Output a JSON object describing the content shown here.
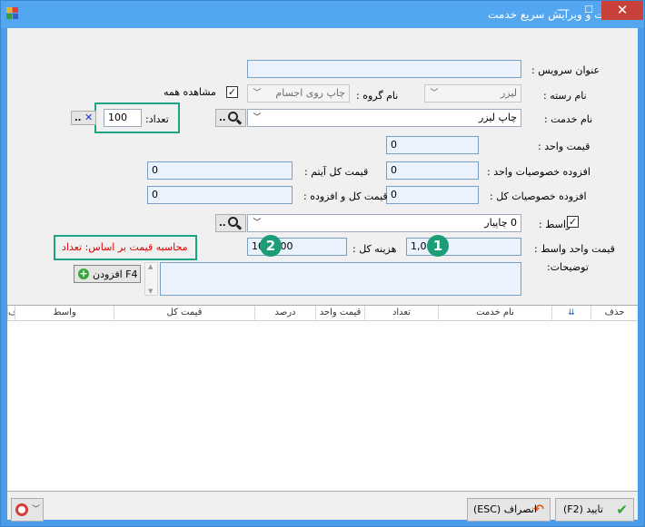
{
  "window": {
    "title": "ثبت و ویرایش سریع خدمت",
    "minimize": "—",
    "maximize": "☐",
    "close": "✕"
  },
  "form": {
    "service_title_label": "عنوان سرویس :",
    "service_title_value": "",
    "category_label": "نام رسته :",
    "category_value": "لیزر",
    "group_label": "نام گروه :",
    "group_value": "چاپ روی اجسام",
    "show_all_label": "مشاهده همه",
    "show_all_checked": "✓",
    "service_name_label": "نام خدمت :",
    "service_name_value": "چاپ لیزر",
    "count_label": "تعداد:",
    "count_value": "100",
    "count_clear": "✕",
    "count_dots": "..",
    "unit_price_label": "قیمت واحد :",
    "unit_price_value": "0",
    "unit_features_label": "افزوده خصوصیات واحد :",
    "unit_features_value": "0",
    "item_total_label": "قیمت کل آیتم :",
    "item_total_value": "0",
    "total_features_label": "افزوده خصوصیات کل :",
    "total_features_value": "0",
    "total_with_addon_label": "قیمت کل و افزوده :",
    "total_with_addon_value": "0",
    "broker_label": "واسط :",
    "broker_checked": "✓",
    "broker_value": "0 چاپیار",
    "broker_dots": "..",
    "broker_unit_price_label": "قیمت واحد واسط :",
    "broker_unit_price_value": "1,000",
    "total_cost_label": "هزینه کل :",
    "total_cost_value": "100,000",
    "calc_basis_label": "محاسبه قیمت بر اساس: تعداد",
    "description_label": "توضیحات:",
    "description_value": "",
    "add_button_label": "افزودن F4",
    "badge_1": "1",
    "badge_2": "2"
  },
  "table": {
    "columns": [
      "حذف",
      "",
      "نام خدمت",
      "تعداد",
      "قیمت واحد",
      "درصد",
      "قیمت کل",
      "واسط",
      "ف"
    ]
  },
  "footer": {
    "confirm_label": "(F2) تایید",
    "cancel_label": "(ESC) انصراف"
  },
  "colors": {
    "accent_teal": "#1ca584",
    "warning_red": "#e00000",
    "title_blue": "#53a6f0"
  }
}
